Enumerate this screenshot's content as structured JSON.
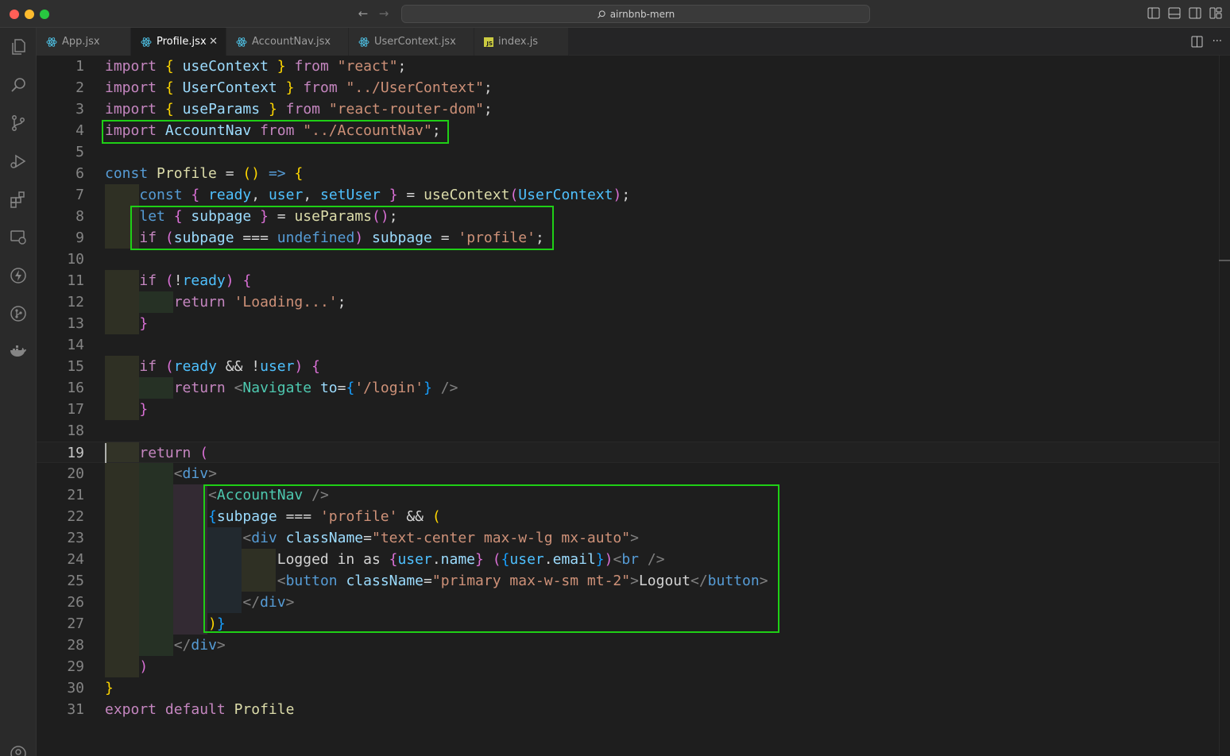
{
  "window": {
    "search_text": "airnbnb-mern"
  },
  "tabs": [
    {
      "label": "App.jsx",
      "icon": "react-icon",
      "active": false
    },
    {
      "label": "Profile.jsx",
      "icon": "react-icon",
      "active": true
    },
    {
      "label": "AccountNav.jsx",
      "icon": "react-icon",
      "active": false
    },
    {
      "label": "UserContext.jsx",
      "icon": "react-icon",
      "active": false
    },
    {
      "label": "index.js",
      "icon": "js-icon",
      "active": false
    }
  ],
  "editor": {
    "current_line": 19,
    "line_numbers": [
      "1",
      "2",
      "3",
      "4",
      "5",
      "6",
      "7",
      "8",
      "9",
      "10",
      "11",
      "12",
      "13",
      "14",
      "15",
      "16",
      "17",
      "18",
      "19",
      "20",
      "21",
      "22",
      "23",
      "24",
      "25",
      "26",
      "27",
      "28",
      "29",
      "30",
      "31"
    ],
    "highlight_color": "#1fcf16"
  },
  "activity_icons": [
    "explorer-icon",
    "search-icon",
    "source-control-icon",
    "run-debug-icon",
    "extensions-icon",
    "remote-explorer-icon",
    "thunder-client-icon",
    "git-graph-icon",
    "docker-icon"
  ],
  "colors": {
    "keyword": "#c586c0",
    "string": "#ce9178",
    "variable": "#9cdcfe",
    "function": "#dcdcaa",
    "tag": "#4ec9b0"
  }
}
